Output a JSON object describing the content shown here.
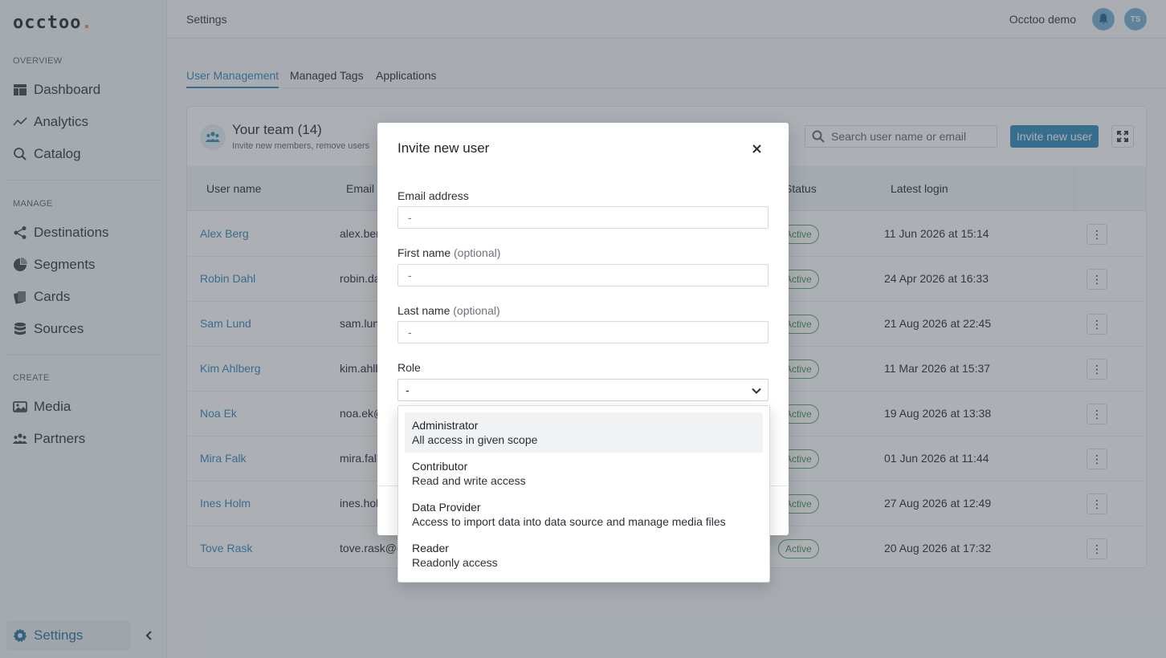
{
  "app": {
    "logo": "occtoo",
    "logo_dot": "."
  },
  "sidebar": {
    "sections": [
      {
        "label": "OVERVIEW",
        "items": [
          {
            "label": "Dashboard",
            "icon": "dashboard-icon"
          },
          {
            "label": "Analytics",
            "icon": "analytics-icon"
          },
          {
            "label": "Catalog",
            "icon": "search-icon"
          }
        ]
      },
      {
        "label": "MANAGE",
        "items": [
          {
            "label": "Destinations",
            "icon": "share-icon"
          },
          {
            "label": "Segments",
            "icon": "pie-icon"
          },
          {
            "label": "Cards",
            "icon": "cards-icon"
          },
          {
            "label": "Sources",
            "icon": "database-icon"
          }
        ]
      },
      {
        "label": "CREATE",
        "items": [
          {
            "label": "Media",
            "icon": "image-icon"
          },
          {
            "label": "Partners",
            "icon": "people-icon"
          }
        ]
      }
    ],
    "settings_label": "Settings"
  },
  "topbar": {
    "breadcrumb": "Settings",
    "org_name": "Occtoo demo",
    "avatar_initials": "TS"
  },
  "tabs": [
    "User Management",
    "Managed Tags",
    "Applications"
  ],
  "team": {
    "title": "Your team (14)",
    "subtitle": "Invite new members, remove users",
    "search_placeholder": "Search user name or email",
    "invite_button": "Invite new user",
    "columns": {
      "username": "User name",
      "email": "Email",
      "status": "Status",
      "login": "Latest login"
    },
    "rows": [
      {
        "name": "Alex Berg",
        "email": "alex.ber",
        "status": "Active",
        "login": "11 Jun 2026 at 15:14"
      },
      {
        "name": "Robin Dahl",
        "email": "robin.da",
        "status": "Active",
        "login": "24 Apr 2026 at 16:33"
      },
      {
        "name": "Sam Lund",
        "email": "sam.lun",
        "status": "Active",
        "login": "21 Aug 2026 at 22:45"
      },
      {
        "name": "Kim Ahlberg",
        "email": "kim.ahlb",
        "status": "Active",
        "login": "11 Mar 2026 at 15:37"
      },
      {
        "name": "Noa Ek",
        "email": "noa.ek@",
        "status": "Active",
        "login": "19 Aug 2026 at 13:38"
      },
      {
        "name": "Mira Falk",
        "email": "mira.fall",
        "status": "Active",
        "login": "01 Jun 2026 at 11:44"
      },
      {
        "name": "Ines Holm",
        "email": "ines.hol",
        "status": "Active",
        "login": "27 Aug 2026 at 12:49"
      },
      {
        "name": "Tove Rask",
        "email": "tove.rask@e",
        "status": "Active",
        "login": "20 Aug 2026 at 17:32"
      }
    ]
  },
  "modal": {
    "title": "Invite new user",
    "email_label": "Email address",
    "email_placeholder": "-",
    "first_label": "First name",
    "first_optional": "(optional)",
    "first_placeholder": "-",
    "last_label": "Last name",
    "last_optional": "(optional)",
    "last_placeholder": "-",
    "role_label": "Role",
    "role_value": "-"
  },
  "role_options": [
    {
      "title": "Administrator",
      "desc": "All access in given scope"
    },
    {
      "title": "Contributor",
      "desc": "Read and write access"
    },
    {
      "title": "Data Provider",
      "desc": "Access to import data into data source and manage media files"
    },
    {
      "title": "Reader",
      "desc": "Readonly access"
    }
  ],
  "colors": {
    "accent": "#2a86b8",
    "active_status": "#3d8a4e",
    "overlay": "rgba(70,80,88,0.45)"
  }
}
